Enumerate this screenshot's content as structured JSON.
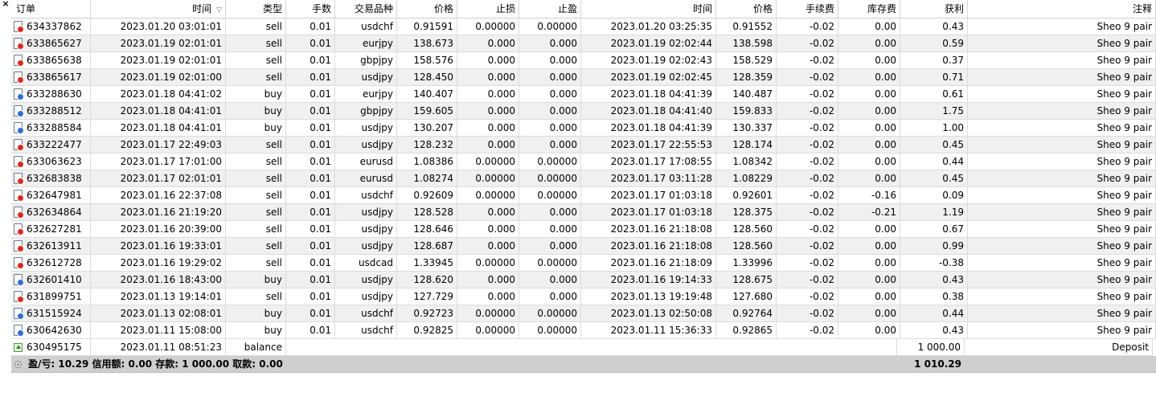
{
  "window": {
    "close_glyph": "×"
  },
  "columns": [
    "订单",
    "时间",
    "类型",
    "手数",
    "交易品种",
    "价格",
    "止损",
    "止盈",
    "时间",
    "价格",
    "手续费",
    "库存费",
    "获利",
    "注释"
  ],
  "sort_indicator": "▽",
  "trades": [
    {
      "order": "634337862",
      "open_time": "2023.01.20 03:01:01",
      "type": "sell",
      "lots": "0.01",
      "symbol": "usdchf",
      "open_price": "0.91591",
      "sl": "0.00000",
      "tp": "0.00000",
      "close_time": "2023.01.20 03:25:35",
      "close_price": "0.91552",
      "commission": "-0.02",
      "swap": "0.00",
      "profit": "0.43",
      "comment": "Sheo 9 pair"
    },
    {
      "order": "633865627",
      "open_time": "2023.01.19 02:01:01",
      "type": "sell",
      "lots": "0.01",
      "symbol": "eurjpy",
      "open_price": "138.673",
      "sl": "0.000",
      "tp": "0.000",
      "close_time": "2023.01.19 02:02:44",
      "close_price": "138.598",
      "commission": "-0.02",
      "swap": "0.00",
      "profit": "0.59",
      "comment": "Sheo 9 pair"
    },
    {
      "order": "633865638",
      "open_time": "2023.01.19 02:01:01",
      "type": "sell",
      "lots": "0.01",
      "symbol": "gbpjpy",
      "open_price": "158.576",
      "sl": "0.000",
      "tp": "0.000",
      "close_time": "2023.01.19 02:02:43",
      "close_price": "158.529",
      "commission": "-0.02",
      "swap": "0.00",
      "profit": "0.37",
      "comment": "Sheo 9 pair"
    },
    {
      "order": "633865617",
      "open_time": "2023.01.19 02:01:00",
      "type": "sell",
      "lots": "0.01",
      "symbol": "usdjpy",
      "open_price": "128.450",
      "sl": "0.000",
      "tp": "0.000",
      "close_time": "2023.01.19 02:02:45",
      "close_price": "128.359",
      "commission": "-0.02",
      "swap": "0.00",
      "profit": "0.71",
      "comment": "Sheo 9 pair"
    },
    {
      "order": "633288630",
      "open_time": "2023.01.18 04:41:02",
      "type": "buy",
      "lots": "0.01",
      "symbol": "eurjpy",
      "open_price": "140.407",
      "sl": "0.000",
      "tp": "0.000",
      "close_time": "2023.01.18 04:41:39",
      "close_price": "140.487",
      "commission": "-0.02",
      "swap": "0.00",
      "profit": "0.61",
      "comment": "Sheo 9 pair"
    },
    {
      "order": "633288512",
      "open_time": "2023.01.18 04:41:01",
      "type": "buy",
      "lots": "0.01",
      "symbol": "gbpjpy",
      "open_price": "159.605",
      "sl": "0.000",
      "tp": "0.000",
      "close_time": "2023.01.18 04:41:40",
      "close_price": "159.833",
      "commission": "-0.02",
      "swap": "0.00",
      "profit": "1.75",
      "comment": "Sheo 9 pair"
    },
    {
      "order": "633288584",
      "open_time": "2023.01.18 04:41:01",
      "type": "buy",
      "lots": "0.01",
      "symbol": "usdjpy",
      "open_price": "130.207",
      "sl": "0.000",
      "tp": "0.000",
      "close_time": "2023.01.18 04:41:39",
      "close_price": "130.337",
      "commission": "-0.02",
      "swap": "0.00",
      "profit": "1.00",
      "comment": "Sheo 9 pair"
    },
    {
      "order": "633222477",
      "open_time": "2023.01.17 22:49:03",
      "type": "sell",
      "lots": "0.01",
      "symbol": "usdjpy",
      "open_price": "128.232",
      "sl": "0.000",
      "tp": "0.000",
      "close_time": "2023.01.17 22:55:53",
      "close_price": "128.174",
      "commission": "-0.02",
      "swap": "0.00",
      "profit": "0.45",
      "comment": "Sheo 9 pair"
    },
    {
      "order": "633063623",
      "open_time": "2023.01.17 17:01:00",
      "type": "sell",
      "lots": "0.01",
      "symbol": "eurusd",
      "open_price": "1.08386",
      "sl": "0.00000",
      "tp": "0.00000",
      "close_time": "2023.01.17 17:08:55",
      "close_price": "1.08342",
      "commission": "-0.02",
      "swap": "0.00",
      "profit": "0.44",
      "comment": "Sheo 9 pair"
    },
    {
      "order": "632683838",
      "open_time": "2023.01.17 02:01:01",
      "type": "sell",
      "lots": "0.01",
      "symbol": "eurusd",
      "open_price": "1.08274",
      "sl": "0.00000",
      "tp": "0.00000",
      "close_time": "2023.01.17 03:11:28",
      "close_price": "1.08229",
      "commission": "-0.02",
      "swap": "0.00",
      "profit": "0.45",
      "comment": "Sheo 9 pair"
    },
    {
      "order": "632647981",
      "open_time": "2023.01.16 22:37:08",
      "type": "sell",
      "lots": "0.01",
      "symbol": "usdchf",
      "open_price": "0.92609",
      "sl": "0.00000",
      "tp": "0.00000",
      "close_time": "2023.01.17 01:03:18",
      "close_price": "0.92601",
      "commission": "-0.02",
      "swap": "-0.16",
      "profit": "0.09",
      "comment": "Sheo 9 pair"
    },
    {
      "order": "632634864",
      "open_time": "2023.01.16 21:19:20",
      "type": "sell",
      "lots": "0.01",
      "symbol": "usdjpy",
      "open_price": "128.528",
      "sl": "0.000",
      "tp": "0.000",
      "close_time": "2023.01.17 01:03:18",
      "close_price": "128.375",
      "commission": "-0.02",
      "swap": "-0.21",
      "profit": "1.19",
      "comment": "Sheo 9 pair"
    },
    {
      "order": "632627281",
      "open_time": "2023.01.16 20:39:00",
      "type": "sell",
      "lots": "0.01",
      "symbol": "usdjpy",
      "open_price": "128.646",
      "sl": "0.000",
      "tp": "0.000",
      "close_time": "2023.01.16 21:18:08",
      "close_price": "128.560",
      "commission": "-0.02",
      "swap": "0.00",
      "profit": "0.67",
      "comment": "Sheo 9 pair"
    },
    {
      "order": "632613911",
      "open_time": "2023.01.16 19:33:01",
      "type": "sell",
      "lots": "0.01",
      "symbol": "usdjpy",
      "open_price": "128.687",
      "sl": "0.000",
      "tp": "0.000",
      "close_time": "2023.01.16 21:18:08",
      "close_price": "128.560",
      "commission": "-0.02",
      "swap": "0.00",
      "profit": "0.99",
      "comment": "Sheo 9 pair"
    },
    {
      "order": "632612728",
      "open_time": "2023.01.16 19:29:02",
      "type": "sell",
      "lots": "0.01",
      "symbol": "usdcad",
      "open_price": "1.33945",
      "sl": "0.00000",
      "tp": "0.00000",
      "close_time": "2023.01.16 21:18:09",
      "close_price": "1.33996",
      "commission": "-0.02",
      "swap": "0.00",
      "profit": "-0.38",
      "comment": "Sheo 9 pair"
    },
    {
      "order": "632601410",
      "open_time": "2023.01.16 18:43:00",
      "type": "buy",
      "lots": "0.01",
      "symbol": "usdjpy",
      "open_price": "128.620",
      "sl": "0.000",
      "tp": "0.000",
      "close_time": "2023.01.16 19:14:33",
      "close_price": "128.675",
      "commission": "-0.02",
      "swap": "0.00",
      "profit": "0.43",
      "comment": "Sheo 9 pair"
    },
    {
      "order": "631899751",
      "open_time": "2023.01.13 19:14:01",
      "type": "sell",
      "lots": "0.01",
      "symbol": "usdjpy",
      "open_price": "127.729",
      "sl": "0.000",
      "tp": "0.000",
      "close_time": "2023.01.13 19:19:48",
      "close_price": "127.680",
      "commission": "-0.02",
      "swap": "0.00",
      "profit": "0.38",
      "comment": "Sheo 9 pair"
    },
    {
      "order": "631515924",
      "open_time": "2023.01.13 02:08:01",
      "type": "buy",
      "lots": "0.01",
      "symbol": "usdchf",
      "open_price": "0.92723",
      "sl": "0.00000",
      "tp": "0.00000",
      "close_time": "2023.01.13 02:50:08",
      "close_price": "0.92764",
      "commission": "-0.02",
      "swap": "0.00",
      "profit": "0.44",
      "comment": "Sheo 9 pair"
    },
    {
      "order": "630642630",
      "open_time": "2023.01.11 15:08:00",
      "type": "buy",
      "lots": "0.01",
      "symbol": "usdchf",
      "open_price": "0.92825",
      "sl": "0.00000",
      "tp": "0.00000",
      "close_time": "2023.01.11 15:36:33",
      "close_price": "0.92865",
      "commission": "-0.02",
      "swap": "0.00",
      "profit": "0.43",
      "comment": "Sheo 9 pair"
    }
  ],
  "balance_row": {
    "order": "630495175",
    "open_time": "2023.01.11 08:51:23",
    "type": "balance",
    "profit": "1 000.00",
    "comment": "Deposit"
  },
  "summary": {
    "text": "盈/亏: 10.29  信用额: 0.00  存款: 1 000.00  取款: 0.00",
    "total": "1 010.29"
  },
  "colors": {
    "sell_dot": "#e0281c",
    "buy_dot": "#2a6fd6",
    "alt_row": "#f0f0f0",
    "summary_bg": "#cfcfcf"
  }
}
